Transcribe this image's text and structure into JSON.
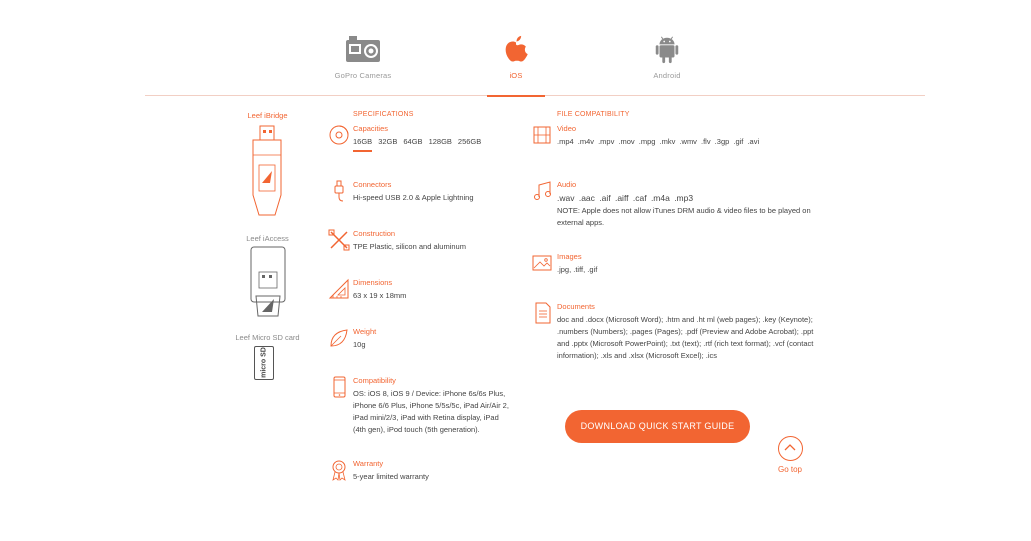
{
  "tabs": [
    {
      "label": "GoPro Cameras",
      "icon": "gopro-camera-icon"
    },
    {
      "label": "iOS",
      "icon": "apple-icon"
    },
    {
      "label": "Android",
      "icon": "android-icon"
    }
  ],
  "devices": [
    {
      "label": "Leef iBridge"
    },
    {
      "label": "Leef iAccess"
    },
    {
      "label": "Leef Micro SD card",
      "card_text": "micro SD"
    }
  ],
  "specs": {
    "title": "SPECIFICATIONS",
    "capacities": {
      "title": "Capacities",
      "sizes": [
        "16GB",
        "32GB",
        "64GB",
        "128GB",
        "256GB"
      ],
      "selected": "16GB"
    },
    "connectors": {
      "title": "Connectors",
      "text": "Hi-speed USB 2.0 & Apple Lightning"
    },
    "construction": {
      "title": "Construction",
      "text": "TPE Plastic, silicon and aluminum"
    },
    "dimensions": {
      "title": "Dimensions",
      "text": "63 x 19 x 18mm"
    },
    "weight": {
      "title": "Weight",
      "text": "10g"
    },
    "compatibility": {
      "title": "Compatibility",
      "lines": [
        "OS: iOS 8, iOS 9 / Device: iPhone 6s/6s Plus,",
        "iPhone 6/6 Plus, iPhone 5/5s/5c, iPad Air/Air 2,",
        "iPad mini/2/3, iPad with Retina display, iPad",
        "(4th gen), iPod touch (5th generation)."
      ]
    },
    "warranty": {
      "title": "Warranty",
      "text": "5-year limited warranty"
    }
  },
  "files": {
    "title": "FILE COMPATIBILITY",
    "video": {
      "title": "Video",
      "text": ".mp4 .m4v .mpv .mov .mpg .mkv .wmv .flv .3gp .gif .avi"
    },
    "audio": {
      "title": "Audio",
      "text": ".wav .aac .aif .aiff .caf .m4a .mp3",
      "note_lines": [
        "NOTE: Apple does not allow iTunes DRM audio & video files to be played on",
        "external apps."
      ]
    },
    "images": {
      "title": "Images",
      "text": ".jpg, .tiff, .gif"
    },
    "documents": {
      "title": "Documents",
      "lines": [
        "doc and .docx (Microsoft Word); .htm and .ht ml (web pages); .key (Keynote);",
        ".numbers (Numbers); .pages (Pages); .pdf (Preview and Adobe Acrobat); .ppt",
        "and .pptx (Microsoft PowerPoint); .txt (text); .rtf (rich text format); .vcf (contact",
        "information); .xls and .xlsx (Microsoft Excel); .ics"
      ]
    }
  },
  "cta": {
    "download_label": "DOWNLOAD QUICK START GUIDE",
    "gotop_label": "Go top"
  },
  "colors": {
    "accent": "#f26532",
    "text": "#444444",
    "muted": "#9a9a9a",
    "icon_gray": "#8a8a8a"
  }
}
